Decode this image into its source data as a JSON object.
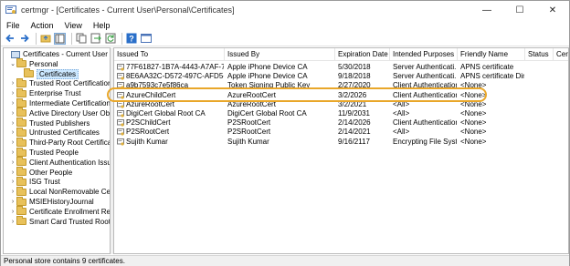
{
  "titlebar": {
    "title": "certmgr - [Certificates - Current User\\Personal\\Certificates]",
    "minimize": "—",
    "maximize": "☐",
    "close": "✕"
  },
  "menu": [
    "File",
    "Action",
    "View",
    "Help"
  ],
  "toolbar": {
    "icons": [
      "back-icon",
      "forward-icon",
      "up-folder-icon",
      "show-hide-tree-icon",
      "copy-icon",
      "export-icon",
      "refresh-icon",
      "help-icon",
      "console-icon"
    ]
  },
  "tree": {
    "root": "Certificates - Current User",
    "personal": "Personal",
    "certificates": "Certificates",
    "stores": [
      "Trusted Root Certification Au",
      "Enterprise Trust",
      "Intermediate Certification Au",
      "Active Directory User Object",
      "Trusted Publishers",
      "Untrusted Certificates",
      "Third-Party Root Certification",
      "Trusted People",
      "Client Authentication Issuers",
      "Other People",
      "ISG Trust",
      "Local NonRemovable Certific",
      "MSIEHistoryJournal",
      "Certificate Enrollment Reque",
      "Smart Card Trusted Roots"
    ]
  },
  "columns": [
    "Issued To",
    "Issued By",
    "Expiration Date",
    "Intended Purposes",
    "Friendly Name",
    "Status",
    "Certi"
  ],
  "rows": [
    {
      "issued_to": "77F61827-1B7A-4443-A7AF-7FD...",
      "issued_by": "Apple iPhone Device CA",
      "expiration": "5/30/2018",
      "purposes": "Server Authenticati...",
      "friendly": "APNS certificate",
      "status": ""
    },
    {
      "issued_to": "8E6AA32C-D572-497C-AFD5-E2...",
      "issued_by": "Apple iPhone Device CA",
      "expiration": "9/18/2018",
      "purposes": "Server Authenticati...",
      "friendly": "APNS certificate Dir...",
      "status": ""
    },
    {
      "issued_to": "a9b7593c7e5f86ca",
      "issued_by": "Token Signing Public Key",
      "expiration": "2/27/2020",
      "purposes": "Client Authentication",
      "friendly": "<None>",
      "status": ""
    },
    {
      "issued_to": "AzureChildCert",
      "issued_by": "AzureRootCert",
      "expiration": "3/2/2026",
      "purposes": "Client Authentication",
      "friendly": "<None>",
      "status": ""
    },
    {
      "issued_to": "AzureRootCert",
      "issued_by": "AzureRootCert",
      "expiration": "3/2/2021",
      "purposes": "<All>",
      "friendly": "<None>",
      "status": ""
    },
    {
      "issued_to": "DigiCert Global Root CA",
      "issued_by": "DigiCert Global Root CA",
      "expiration": "11/9/2031",
      "purposes": "<All>",
      "friendly": "<None>",
      "status": ""
    },
    {
      "issued_to": "P2SChildCert",
      "issued_by": "P2SRootCert",
      "expiration": "2/14/2026",
      "purposes": "Client Authentication",
      "friendly": "<None>",
      "status": ""
    },
    {
      "issued_to": "P2SRootCert",
      "issued_by": "P2SRootCert",
      "expiration": "2/14/2021",
      "purposes": "<All>",
      "friendly": "<None>",
      "status": ""
    },
    {
      "issued_to": "Sujith Kumar",
      "issued_by": "Sujith Kumar",
      "expiration": "9/16/2117",
      "purposes": "Encrypting File Syst...",
      "friendly": "<None>",
      "status": ""
    }
  ],
  "status": "Personal store contains 9 certificates.",
  "colors": {
    "highlight": "#e9a72a",
    "folder": "#e8c15a",
    "selection": "#cce8ff"
  }
}
